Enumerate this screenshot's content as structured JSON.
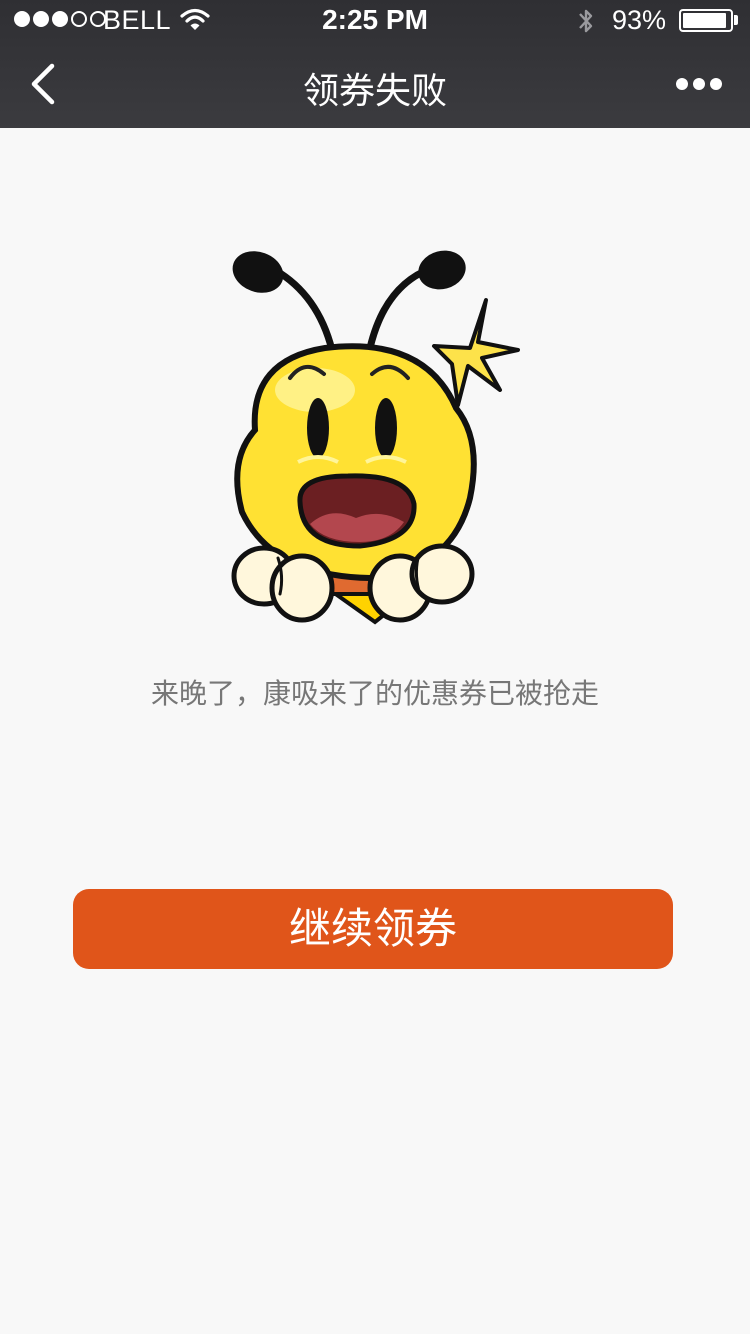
{
  "status_bar": {
    "signal_total": 5,
    "signal_filled": 3,
    "carrier": "BELL",
    "time": "2:25 PM",
    "battery_percent": "93%",
    "battery_level": 0.93,
    "icons": [
      "wifi-icon",
      "bluetooth-icon",
      "battery-icon"
    ]
  },
  "nav": {
    "title": "领券失败",
    "back_icon": "chevron-left-icon",
    "more_icon": "more-dots-icon"
  },
  "main": {
    "illustration": "bee-mascot-shocked",
    "message": "来晚了，康吸来了的优惠券已被抢走",
    "continue_button_label": "继续领券"
  },
  "colors": {
    "top_bar": "#333337",
    "page_background": "#f8f8f8",
    "button": "#e0551a",
    "message_text": "#777777"
  }
}
